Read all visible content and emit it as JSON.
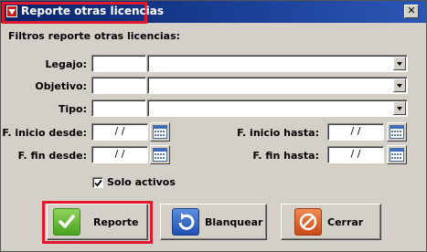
{
  "window": {
    "title": "Reporte otras licencias",
    "close_glyph": "✕"
  },
  "form": {
    "heading": "Filtros reporte otras licencias:",
    "legajo": {
      "label": "Legajo:",
      "code": "",
      "value": ""
    },
    "objetivo": {
      "label": "Objetivo:",
      "code": "",
      "value": ""
    },
    "tipo": {
      "label": "Tipo:",
      "code": "",
      "value": ""
    },
    "f_inicio_desde": {
      "label": "F. inicio desde:",
      "value": "/ /"
    },
    "f_inicio_hasta": {
      "label": "F. inicio hasta:",
      "value": "/ /"
    },
    "f_fin_desde": {
      "label": "F. fin desde:",
      "value": "/ /"
    },
    "f_fin_hasta": {
      "label": "F. fin hasta:",
      "value": "/ /"
    },
    "solo_activos": {
      "label": "Solo activos",
      "checked": true
    }
  },
  "buttons": {
    "reporte": "Reporte",
    "blanquear": "Blanquear",
    "cerrar": "Cerrar"
  },
  "colors": {
    "title_bar": "#0a246a",
    "highlight": "#e0192c",
    "reporte_icon": "#5cb82c",
    "blanquear_icon": "#2a63c8",
    "cerrar_icon": "#d8622a"
  },
  "icons": {
    "window": "report-icon",
    "calendar": "calendar-icon",
    "reporte": "check-icon",
    "blanquear": "refresh-icon",
    "cerrar": "cancel-icon"
  }
}
